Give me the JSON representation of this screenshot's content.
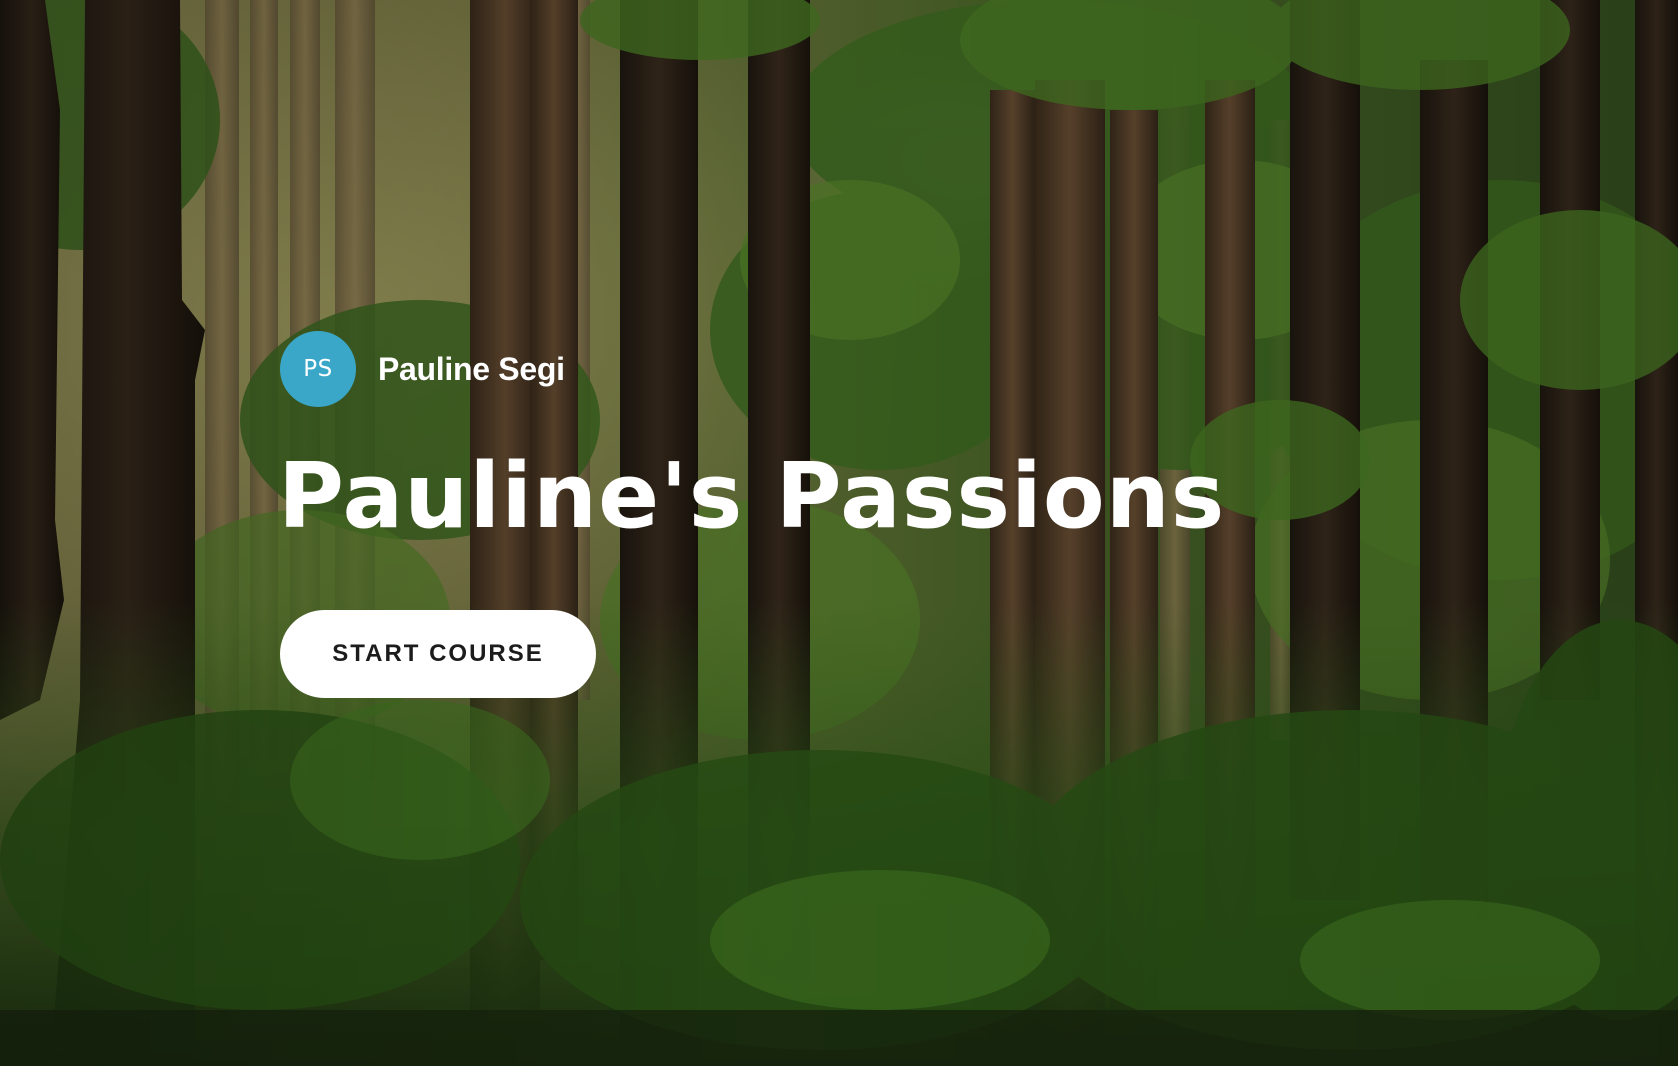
{
  "hero": {
    "background": "forest-photo",
    "author": {
      "initials": "PS",
      "name": "Pauline Segi",
      "avatar_color": "#3aa7c9"
    },
    "title": "Pauline's Passions",
    "start_button_label": "START COURSE"
  }
}
